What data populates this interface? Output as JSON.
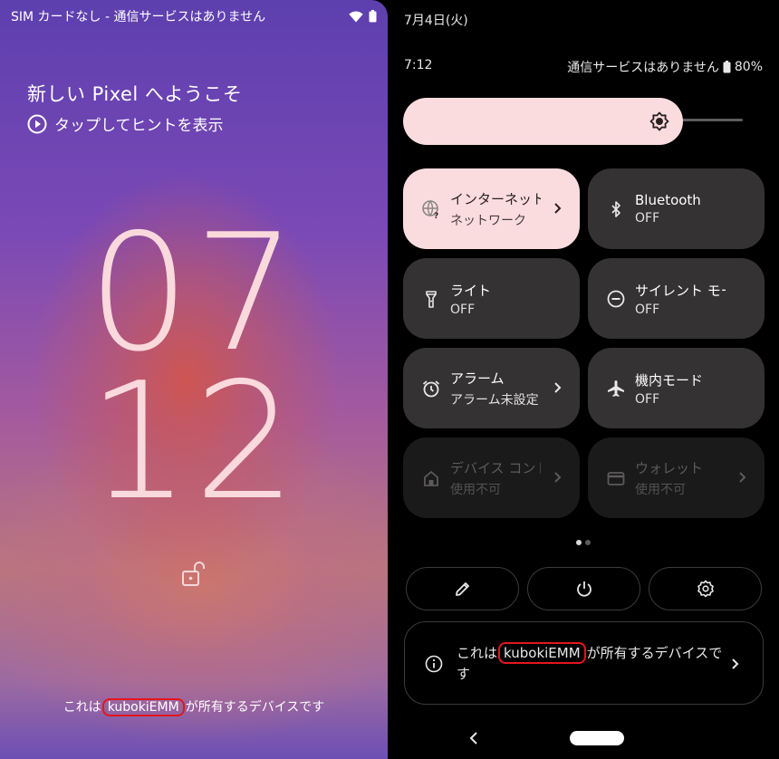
{
  "lock": {
    "status_text": "SIM カードなし - 通信サービスはありません",
    "wifi_icon": "wifi-icon",
    "battery_icon": "battery-icon",
    "welcome": "新しい Pixel へようこそ",
    "hint": "タップしてヒントを表示",
    "clock_hours": "07",
    "clock_minutes": "12",
    "owner_prefix": "これは",
    "owner_name": "kubokiEMM",
    "owner_suffix": "が所有するデバイスです"
  },
  "qs": {
    "date": "7月4日(火)",
    "time": "7:12",
    "service": "通信サービスはありません",
    "battery": "80%",
    "brightness": {
      "level": 0.7,
      "icon": "brightness-icon"
    },
    "tiles": [
      {
        "title": "インターネット",
        "subtitle": "ネットワーク",
        "icon": "internet-icon",
        "state": "active",
        "chevron": true
      },
      {
        "title": "Bluetooth",
        "subtitle": "OFF",
        "icon": "bluetooth-icon",
        "state": "off",
        "chevron": false
      },
      {
        "title": "ライト",
        "subtitle": "OFF",
        "icon": "flashlight-icon",
        "state": "off",
        "chevron": false
      },
      {
        "title": "サイレント モード",
        "subtitle": "OFF",
        "icon": "do-not-disturb-icon",
        "state": "off",
        "chevron": false
      },
      {
        "title": "アラーム",
        "subtitle": "アラーム未設定",
        "icon": "alarm-icon",
        "state": "off",
        "chevron": true
      },
      {
        "title": "機内モード",
        "subtitle": "OFF",
        "icon": "airplane-icon",
        "state": "off",
        "chevron": false
      },
      {
        "title": "デバイス コントロール",
        "subtitle": "使用不可",
        "icon": "home-icon",
        "state": "disabled",
        "chevron": true
      },
      {
        "title": "ウォレット",
        "subtitle": "使用不可",
        "icon": "wallet-icon",
        "state": "disabled",
        "chevron": true
      }
    ],
    "page_indicator": {
      "current": 1,
      "total": 2
    },
    "actions": [
      {
        "icon": "edit-icon"
      },
      {
        "icon": "power-icon"
      },
      {
        "icon": "settings-icon"
      }
    ],
    "footer": {
      "prefix": "これは",
      "owner_name": "kubokiEMM",
      "suffix": "が所有するデバイスです",
      "icon": "info-icon"
    }
  }
}
